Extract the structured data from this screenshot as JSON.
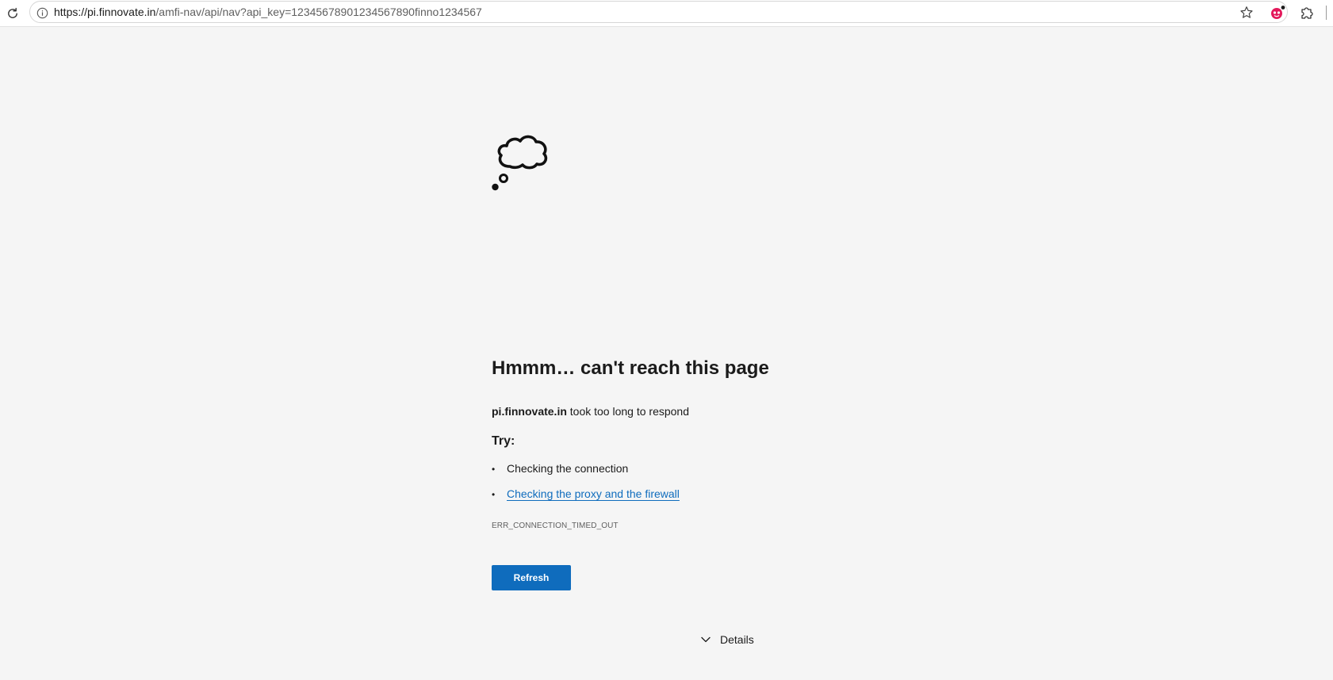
{
  "toolbar": {
    "url_host": "https://pi.finnovate.in",
    "url_path": "/amfi-nav/api/nav?api_key=12345678901234567890finno1234567",
    "icons": {
      "reload": "reload-icon",
      "site_info": "info-icon",
      "favorite": "star-icon",
      "extension_avatar": "extension-avatar-icon",
      "extensions": "puzzle-icon"
    },
    "avatar_color": "#e3195b"
  },
  "error_page": {
    "icon": "thought-cloud-icon",
    "title": "Hmmm… can't reach this page",
    "host": "pi.finnovate.in",
    "description_suffix": " took too long to respond",
    "try_label": "Try:",
    "suggestions": [
      {
        "text": "Checking the connection",
        "is_link": false
      },
      {
        "text": "Checking the proxy and the firewall",
        "is_link": true
      }
    ],
    "error_code": "ERR_CONNECTION_TIMED_OUT",
    "refresh_label": "Refresh",
    "details_label": "Details",
    "accent_color": "#0f6cbd",
    "link_color": "#0f6cbd"
  }
}
